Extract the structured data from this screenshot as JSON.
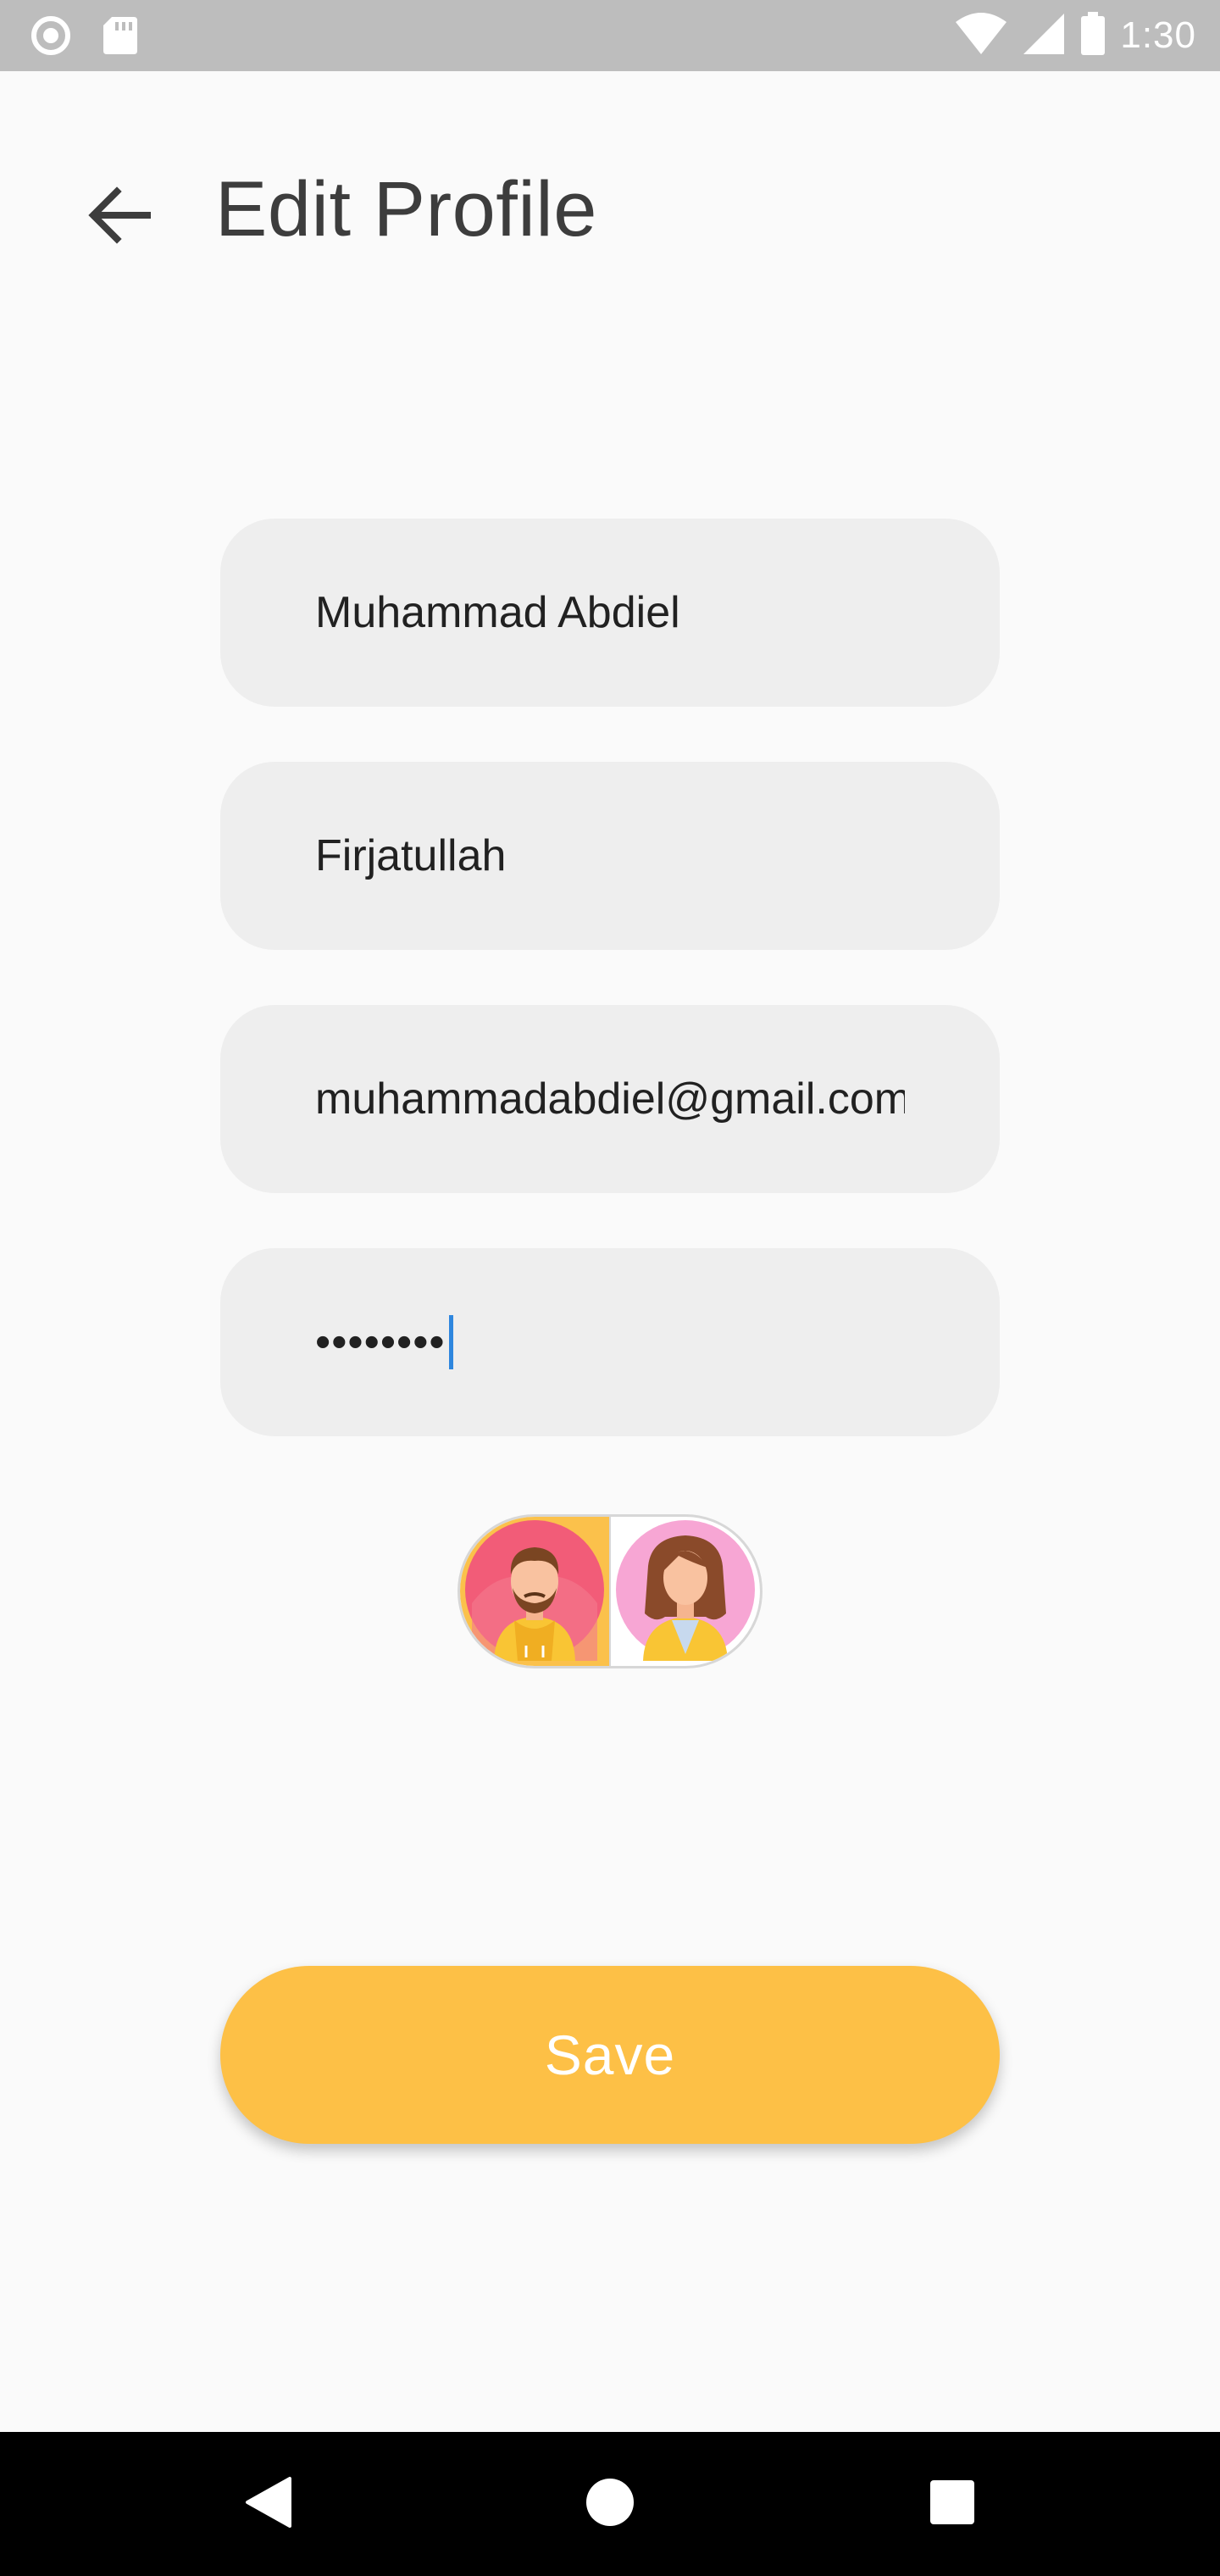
{
  "status_bar": {
    "time": "1:30",
    "icons": [
      "record-icon",
      "sd-card-icon",
      "wifi-icon",
      "signal-icon",
      "battery-icon"
    ]
  },
  "header": {
    "title": "Edit Profile",
    "back_icon": "arrow-left-icon"
  },
  "form": {
    "first_name": "Muhammad Abdiel",
    "last_name": "Firjatullah",
    "email": "muhammadabdiel@gmail.com",
    "password_mask": "••••••••"
  },
  "avatar_toggle": {
    "options": [
      "male-avatar-icon",
      "female-avatar-icon"
    ],
    "selected_index": 0
  },
  "save_button": {
    "label": "Save"
  },
  "nav_bar": {
    "icons": [
      "nav-back-icon",
      "nav-home-icon",
      "nav-recents-icon"
    ]
  },
  "colors": {
    "background": "#fafafa",
    "field_background": "#eeeeee",
    "accent": "#fdc046",
    "title_text": "#3d3d3d",
    "caret": "#2e86de"
  }
}
